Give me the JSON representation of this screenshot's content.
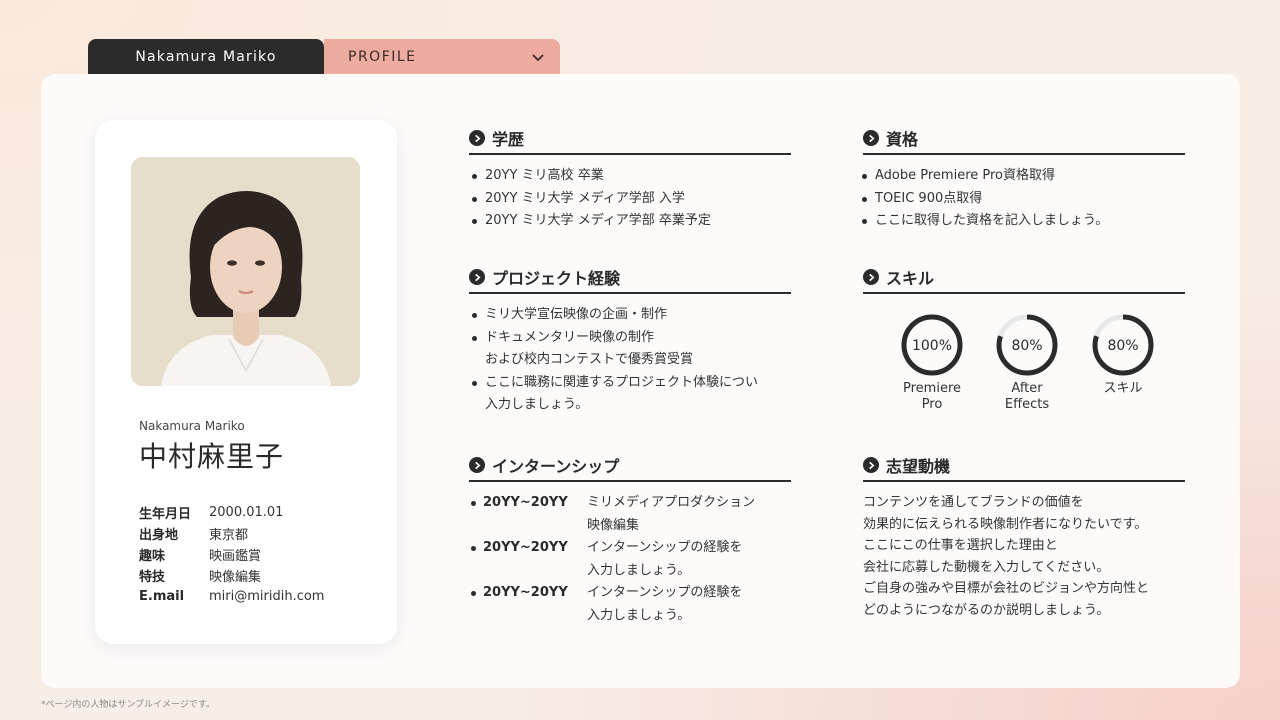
{
  "tabs": {
    "name": "Nakamura Mariko",
    "profile": "PROFILE"
  },
  "profile": {
    "name_roman": "Nakamura Mariko",
    "name_kanji": "中村麻里子",
    "info": [
      {
        "label": "生年月日",
        "value": "2000.01.01"
      },
      {
        "label": "出身地",
        "value": "東京都"
      },
      {
        "label": "趣味",
        "value": "映画鑑賞"
      },
      {
        "label": "特技",
        "value": "映像編集"
      },
      {
        "label": "E.mail",
        "value": "miri@miridih.com"
      }
    ]
  },
  "education": {
    "title": "学歴",
    "items": [
      "20YY ミリ高校 卒業",
      "20YY ミリ大学 メディア学部 入学",
      "20YY ミリ大学 メディア学部 卒業予定"
    ]
  },
  "project": {
    "title": "プロジェクト経験",
    "items": [
      "ミリ大学宣伝映像の企画・制作",
      "ドキュメンタリー映像の制作\nおよび校内コンテストで優秀賞受賞",
      "ここに職務に関連するプロジェクト体験につい\n入力しましょう。"
    ]
  },
  "internship": {
    "title": "インターンシップ",
    "items": [
      {
        "period": "20YY~20YY",
        "desc": "ミリメディアプロダクション\n映像編集"
      },
      {
        "period": "20YY~20YY",
        "desc": "インターンシップの経験を\n入力しましょう。"
      },
      {
        "period": "20YY~20YY",
        "desc": "インターンシップの経験を\n入力しましょう。"
      }
    ]
  },
  "qualifications": {
    "title": "資格",
    "items": [
      "Adobe Premiere Pro資格取得",
      "TOEIC 900点取得",
      "ここに取得した資格を記入しましょう。"
    ]
  },
  "skills": {
    "title": "スキル",
    "items": [
      {
        "label": "Premiere\nPro",
        "percent": 100,
        "percent_text": "100%"
      },
      {
        "label": "After\nEffects",
        "percent": 80,
        "percent_text": "80%"
      },
      {
        "label": "スキル",
        "percent": 80,
        "percent_text": "80%"
      }
    ]
  },
  "motivation": {
    "title": "志望動機",
    "text": "コンテンツを通してブランドの価値を\n効果的に伝えられる映像制作者になりたいです。\nここにこの仕事を選択した理由と\n会社に応募した動機を入力してください。\nご自身の強みや目標が会社のビジョンや方向性と\nどのようにつながるのか説明しましょう。"
  },
  "footnote": "*ページ内の人物はサンプルイメージです。",
  "colors": {
    "dark": "#2b2b2b",
    "accent_tab": "#eeaba0",
    "ring_track": "#e8e8e8"
  }
}
